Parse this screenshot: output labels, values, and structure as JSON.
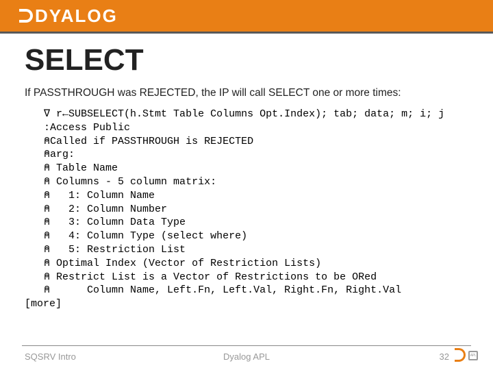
{
  "brand": {
    "name": "DYALOG"
  },
  "title": "SELECT",
  "intro": "If PASSTHROUGH was REJECTED, the IP will call SELECT one or more times:",
  "code": {
    "l01": "∇ r←SUBSELECT(h.Stmt Table Columns Opt.Index); tab; data; m; i; j",
    "l02": ":Access Public",
    "l03": "⍝Called if PASSTHROUGH is REJECTED",
    "l04": "⍝arg:",
    "l05": "⍝ Table Name",
    "l06": "⍝ Columns - 5 column matrix:",
    "l07": "⍝   1: Column Name",
    "l08": "⍝   2: Column Number",
    "l09": "⍝   3: Column Data Type",
    "l10": "⍝   4: Column Type (select where)",
    "l11": "⍝   5: Restriction List",
    "l12": "⍝ Optimal Index (Vector of Restriction Lists)",
    "l13": "⍝ Restrict List is a Vector of Restrictions to be ORed",
    "l14": "⍝      Column Name, Left.Fn, Left.Val, Right.Fn, Right.Val",
    "more": "[more]"
  },
  "footer": {
    "left": "SQSRV Intro",
    "center": "Dyalog APL",
    "page": "32",
    "apl": "APL"
  }
}
